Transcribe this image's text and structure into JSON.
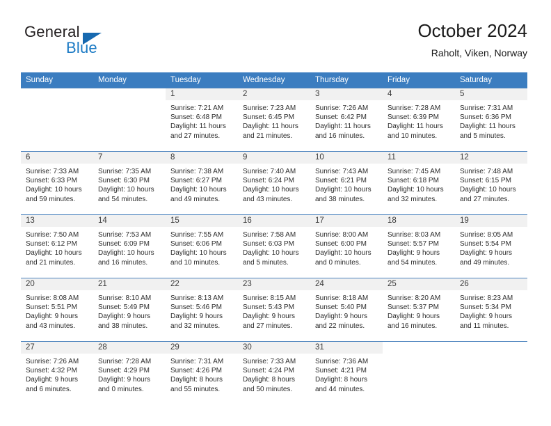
{
  "brand": {
    "name_top": "General",
    "name_bottom": "Blue",
    "triangle_color": "#1769b0",
    "blue_color": "#1b7ac4"
  },
  "header": {
    "title": "October 2024",
    "location": "Raholt, Viken, Norway"
  },
  "colors": {
    "header_row_bg": "#3b7dc0",
    "daynum_bg": "#f1f1f1",
    "row_border": "#4a82bd",
    "text": "#2b2b2b"
  },
  "weekday_headers": [
    "Sunday",
    "Monday",
    "Tuesday",
    "Wednesday",
    "Thursday",
    "Friday",
    "Saturday"
  ],
  "labels": {
    "sunrise": "Sunrise:",
    "sunset": "Sunset:",
    "daylight": "Daylight:"
  },
  "weeks": [
    [
      {
        "day": "",
        "blank": true
      },
      {
        "day": "",
        "blank": true
      },
      {
        "day": "1",
        "sunrise": "Sunrise: 7:21 AM",
        "sunset": "Sunset: 6:48 PM",
        "daylight": "Daylight: 11 hours and 27 minutes."
      },
      {
        "day": "2",
        "sunrise": "Sunrise: 7:23 AM",
        "sunset": "Sunset: 6:45 PM",
        "daylight": "Daylight: 11 hours and 21 minutes."
      },
      {
        "day": "3",
        "sunrise": "Sunrise: 7:26 AM",
        "sunset": "Sunset: 6:42 PM",
        "daylight": "Daylight: 11 hours and 16 minutes."
      },
      {
        "day": "4",
        "sunrise": "Sunrise: 7:28 AM",
        "sunset": "Sunset: 6:39 PM",
        "daylight": "Daylight: 11 hours and 10 minutes."
      },
      {
        "day": "5",
        "sunrise": "Sunrise: 7:31 AM",
        "sunset": "Sunset: 6:36 PM",
        "daylight": "Daylight: 11 hours and 5 minutes."
      }
    ],
    [
      {
        "day": "6",
        "sunrise": "Sunrise: 7:33 AM",
        "sunset": "Sunset: 6:33 PM",
        "daylight": "Daylight: 10 hours and 59 minutes."
      },
      {
        "day": "7",
        "sunrise": "Sunrise: 7:35 AM",
        "sunset": "Sunset: 6:30 PM",
        "daylight": "Daylight: 10 hours and 54 minutes."
      },
      {
        "day": "8",
        "sunrise": "Sunrise: 7:38 AM",
        "sunset": "Sunset: 6:27 PM",
        "daylight": "Daylight: 10 hours and 49 minutes."
      },
      {
        "day": "9",
        "sunrise": "Sunrise: 7:40 AM",
        "sunset": "Sunset: 6:24 PM",
        "daylight": "Daylight: 10 hours and 43 minutes."
      },
      {
        "day": "10",
        "sunrise": "Sunrise: 7:43 AM",
        "sunset": "Sunset: 6:21 PM",
        "daylight": "Daylight: 10 hours and 38 minutes."
      },
      {
        "day": "11",
        "sunrise": "Sunrise: 7:45 AM",
        "sunset": "Sunset: 6:18 PM",
        "daylight": "Daylight: 10 hours and 32 minutes."
      },
      {
        "day": "12",
        "sunrise": "Sunrise: 7:48 AM",
        "sunset": "Sunset: 6:15 PM",
        "daylight": "Daylight: 10 hours and 27 minutes."
      }
    ],
    [
      {
        "day": "13",
        "sunrise": "Sunrise: 7:50 AM",
        "sunset": "Sunset: 6:12 PM",
        "daylight": "Daylight: 10 hours and 21 minutes."
      },
      {
        "day": "14",
        "sunrise": "Sunrise: 7:53 AM",
        "sunset": "Sunset: 6:09 PM",
        "daylight": "Daylight: 10 hours and 16 minutes."
      },
      {
        "day": "15",
        "sunrise": "Sunrise: 7:55 AM",
        "sunset": "Sunset: 6:06 PM",
        "daylight": "Daylight: 10 hours and 10 minutes."
      },
      {
        "day": "16",
        "sunrise": "Sunrise: 7:58 AM",
        "sunset": "Sunset: 6:03 PM",
        "daylight": "Daylight: 10 hours and 5 minutes."
      },
      {
        "day": "17",
        "sunrise": "Sunrise: 8:00 AM",
        "sunset": "Sunset: 6:00 PM",
        "daylight": "Daylight: 10 hours and 0 minutes."
      },
      {
        "day": "18",
        "sunrise": "Sunrise: 8:03 AM",
        "sunset": "Sunset: 5:57 PM",
        "daylight": "Daylight: 9 hours and 54 minutes."
      },
      {
        "day": "19",
        "sunrise": "Sunrise: 8:05 AM",
        "sunset": "Sunset: 5:54 PM",
        "daylight": "Daylight: 9 hours and 49 minutes."
      }
    ],
    [
      {
        "day": "20",
        "sunrise": "Sunrise: 8:08 AM",
        "sunset": "Sunset: 5:51 PM",
        "daylight": "Daylight: 9 hours and 43 minutes."
      },
      {
        "day": "21",
        "sunrise": "Sunrise: 8:10 AM",
        "sunset": "Sunset: 5:49 PM",
        "daylight": "Daylight: 9 hours and 38 minutes."
      },
      {
        "day": "22",
        "sunrise": "Sunrise: 8:13 AM",
        "sunset": "Sunset: 5:46 PM",
        "daylight": "Daylight: 9 hours and 32 minutes."
      },
      {
        "day": "23",
        "sunrise": "Sunrise: 8:15 AM",
        "sunset": "Sunset: 5:43 PM",
        "daylight": "Daylight: 9 hours and 27 minutes."
      },
      {
        "day": "24",
        "sunrise": "Sunrise: 8:18 AM",
        "sunset": "Sunset: 5:40 PM",
        "daylight": "Daylight: 9 hours and 22 minutes."
      },
      {
        "day": "25",
        "sunrise": "Sunrise: 8:20 AM",
        "sunset": "Sunset: 5:37 PM",
        "daylight": "Daylight: 9 hours and 16 minutes."
      },
      {
        "day": "26",
        "sunrise": "Sunrise: 8:23 AM",
        "sunset": "Sunset: 5:34 PM",
        "daylight": "Daylight: 9 hours and 11 minutes."
      }
    ],
    [
      {
        "day": "27",
        "sunrise": "Sunrise: 7:26 AM",
        "sunset": "Sunset: 4:32 PM",
        "daylight": "Daylight: 9 hours and 6 minutes."
      },
      {
        "day": "28",
        "sunrise": "Sunrise: 7:28 AM",
        "sunset": "Sunset: 4:29 PM",
        "daylight": "Daylight: 9 hours and 0 minutes."
      },
      {
        "day": "29",
        "sunrise": "Sunrise: 7:31 AM",
        "sunset": "Sunset: 4:26 PM",
        "daylight": "Daylight: 8 hours and 55 minutes."
      },
      {
        "day": "30",
        "sunrise": "Sunrise: 7:33 AM",
        "sunset": "Sunset: 4:24 PM",
        "daylight": "Daylight: 8 hours and 50 minutes."
      },
      {
        "day": "31",
        "sunrise": "Sunrise: 7:36 AM",
        "sunset": "Sunset: 4:21 PM",
        "daylight": "Daylight: 8 hours and 44 minutes."
      },
      {
        "day": "",
        "blank": true
      },
      {
        "day": "",
        "blank": true
      }
    ]
  ]
}
